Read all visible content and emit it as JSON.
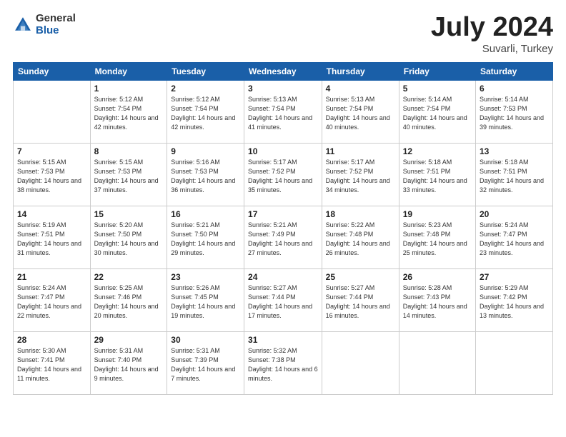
{
  "header": {
    "logo_general": "General",
    "logo_blue": "Blue",
    "title_month": "July 2024",
    "title_location": "Suvarli, Turkey"
  },
  "days_of_week": [
    "Sunday",
    "Monday",
    "Tuesday",
    "Wednesday",
    "Thursday",
    "Friday",
    "Saturday"
  ],
  "weeks": [
    [
      {
        "day": "",
        "empty": true
      },
      {
        "day": "1",
        "sunrise": "Sunrise: 5:12 AM",
        "sunset": "Sunset: 7:54 PM",
        "daylight": "Daylight: 14 hours and 42 minutes."
      },
      {
        "day": "2",
        "sunrise": "Sunrise: 5:12 AM",
        "sunset": "Sunset: 7:54 PM",
        "daylight": "Daylight: 14 hours and 42 minutes."
      },
      {
        "day": "3",
        "sunrise": "Sunrise: 5:13 AM",
        "sunset": "Sunset: 7:54 PM",
        "daylight": "Daylight: 14 hours and 41 minutes."
      },
      {
        "day": "4",
        "sunrise": "Sunrise: 5:13 AM",
        "sunset": "Sunset: 7:54 PM",
        "daylight": "Daylight: 14 hours and 40 minutes."
      },
      {
        "day": "5",
        "sunrise": "Sunrise: 5:14 AM",
        "sunset": "Sunset: 7:54 PM",
        "daylight": "Daylight: 14 hours and 40 minutes."
      },
      {
        "day": "6",
        "sunrise": "Sunrise: 5:14 AM",
        "sunset": "Sunset: 7:53 PM",
        "daylight": "Daylight: 14 hours and 39 minutes."
      }
    ],
    [
      {
        "day": "7",
        "sunrise": "Sunrise: 5:15 AM",
        "sunset": "Sunset: 7:53 PM",
        "daylight": "Daylight: 14 hours and 38 minutes."
      },
      {
        "day": "8",
        "sunrise": "Sunrise: 5:15 AM",
        "sunset": "Sunset: 7:53 PM",
        "daylight": "Daylight: 14 hours and 37 minutes."
      },
      {
        "day": "9",
        "sunrise": "Sunrise: 5:16 AM",
        "sunset": "Sunset: 7:53 PM",
        "daylight": "Daylight: 14 hours and 36 minutes."
      },
      {
        "day": "10",
        "sunrise": "Sunrise: 5:17 AM",
        "sunset": "Sunset: 7:52 PM",
        "daylight": "Daylight: 14 hours and 35 minutes."
      },
      {
        "day": "11",
        "sunrise": "Sunrise: 5:17 AM",
        "sunset": "Sunset: 7:52 PM",
        "daylight": "Daylight: 14 hours and 34 minutes."
      },
      {
        "day": "12",
        "sunrise": "Sunrise: 5:18 AM",
        "sunset": "Sunset: 7:51 PM",
        "daylight": "Daylight: 14 hours and 33 minutes."
      },
      {
        "day": "13",
        "sunrise": "Sunrise: 5:18 AM",
        "sunset": "Sunset: 7:51 PM",
        "daylight": "Daylight: 14 hours and 32 minutes."
      }
    ],
    [
      {
        "day": "14",
        "sunrise": "Sunrise: 5:19 AM",
        "sunset": "Sunset: 7:51 PM",
        "daylight": "Daylight: 14 hours and 31 minutes."
      },
      {
        "day": "15",
        "sunrise": "Sunrise: 5:20 AM",
        "sunset": "Sunset: 7:50 PM",
        "daylight": "Daylight: 14 hours and 30 minutes."
      },
      {
        "day": "16",
        "sunrise": "Sunrise: 5:21 AM",
        "sunset": "Sunset: 7:50 PM",
        "daylight": "Daylight: 14 hours and 29 minutes."
      },
      {
        "day": "17",
        "sunrise": "Sunrise: 5:21 AM",
        "sunset": "Sunset: 7:49 PM",
        "daylight": "Daylight: 14 hours and 27 minutes."
      },
      {
        "day": "18",
        "sunrise": "Sunrise: 5:22 AM",
        "sunset": "Sunset: 7:48 PM",
        "daylight": "Daylight: 14 hours and 26 minutes."
      },
      {
        "day": "19",
        "sunrise": "Sunrise: 5:23 AM",
        "sunset": "Sunset: 7:48 PM",
        "daylight": "Daylight: 14 hours and 25 minutes."
      },
      {
        "day": "20",
        "sunrise": "Sunrise: 5:24 AM",
        "sunset": "Sunset: 7:47 PM",
        "daylight": "Daylight: 14 hours and 23 minutes."
      }
    ],
    [
      {
        "day": "21",
        "sunrise": "Sunrise: 5:24 AM",
        "sunset": "Sunset: 7:47 PM",
        "daylight": "Daylight: 14 hours and 22 minutes."
      },
      {
        "day": "22",
        "sunrise": "Sunrise: 5:25 AM",
        "sunset": "Sunset: 7:46 PM",
        "daylight": "Daylight: 14 hours and 20 minutes."
      },
      {
        "day": "23",
        "sunrise": "Sunrise: 5:26 AM",
        "sunset": "Sunset: 7:45 PM",
        "daylight": "Daylight: 14 hours and 19 minutes."
      },
      {
        "day": "24",
        "sunrise": "Sunrise: 5:27 AM",
        "sunset": "Sunset: 7:44 PM",
        "daylight": "Daylight: 14 hours and 17 minutes."
      },
      {
        "day": "25",
        "sunrise": "Sunrise: 5:27 AM",
        "sunset": "Sunset: 7:44 PM",
        "daylight": "Daylight: 14 hours and 16 minutes."
      },
      {
        "day": "26",
        "sunrise": "Sunrise: 5:28 AM",
        "sunset": "Sunset: 7:43 PM",
        "daylight": "Daylight: 14 hours and 14 minutes."
      },
      {
        "day": "27",
        "sunrise": "Sunrise: 5:29 AM",
        "sunset": "Sunset: 7:42 PM",
        "daylight": "Daylight: 14 hours and 13 minutes."
      }
    ],
    [
      {
        "day": "28",
        "sunrise": "Sunrise: 5:30 AM",
        "sunset": "Sunset: 7:41 PM",
        "daylight": "Daylight: 14 hours and 11 minutes."
      },
      {
        "day": "29",
        "sunrise": "Sunrise: 5:31 AM",
        "sunset": "Sunset: 7:40 PM",
        "daylight": "Daylight: 14 hours and 9 minutes."
      },
      {
        "day": "30",
        "sunrise": "Sunrise: 5:31 AM",
        "sunset": "Sunset: 7:39 PM",
        "daylight": "Daylight: 14 hours and 7 minutes."
      },
      {
        "day": "31",
        "sunrise": "Sunrise: 5:32 AM",
        "sunset": "Sunset: 7:38 PM",
        "daylight": "Daylight: 14 hours and 6 minutes."
      },
      {
        "day": "",
        "empty": true
      },
      {
        "day": "",
        "empty": true
      },
      {
        "day": "",
        "empty": true
      }
    ]
  ]
}
